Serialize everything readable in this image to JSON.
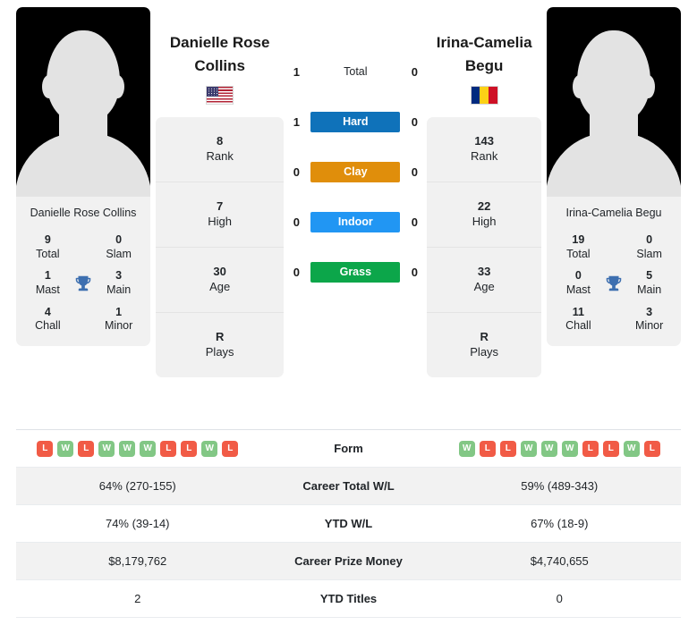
{
  "players": {
    "left": {
      "name": "Danielle Rose Collins",
      "photo_caption": "Danielle Rose Collins",
      "country_code": "us",
      "titles": {
        "total_num": "9",
        "total_label": "Total",
        "slam_num": "0",
        "slam_label": "Slam",
        "mast_num": "1",
        "mast_label": "Mast",
        "main_num": "3",
        "main_label": "Main",
        "chall_num": "4",
        "chall_label": "Chall",
        "minor_num": "1",
        "minor_label": "Minor"
      },
      "attributes": [
        {
          "value": "8",
          "label": "Rank"
        },
        {
          "value": "7",
          "label": "High"
        },
        {
          "value": "30",
          "label": "Age"
        },
        {
          "value": "R",
          "label": "Plays"
        }
      ],
      "surface_scores": {
        "total": "1",
        "hard": "1",
        "clay": "0",
        "indoor": "0",
        "grass": "0"
      },
      "form": [
        "L",
        "W",
        "L",
        "W",
        "W",
        "W",
        "L",
        "L",
        "W",
        "L"
      ],
      "career_total_wl": "64% (270-155)",
      "ytd_wl": "74% (39-14)",
      "career_prize_money": "$8,179,762",
      "ytd_titles": "2"
    },
    "right": {
      "name": "Irina-Camelia Begu",
      "photo_caption": "Irina-Camelia Begu",
      "country_code": "ro",
      "titles": {
        "total_num": "19",
        "total_label": "Total",
        "slam_num": "0",
        "slam_label": "Slam",
        "mast_num": "0",
        "mast_label": "Mast",
        "main_num": "5",
        "main_label": "Main",
        "chall_num": "11",
        "chall_label": "Chall",
        "minor_num": "3",
        "minor_label": "Minor"
      },
      "attributes": [
        {
          "value": "143",
          "label": "Rank"
        },
        {
          "value": "22",
          "label": "High"
        },
        {
          "value": "33",
          "label": "Age"
        },
        {
          "value": "R",
          "label": "Plays"
        }
      ],
      "surface_scores": {
        "total": "0",
        "hard": "0",
        "clay": "0",
        "indoor": "0",
        "grass": "0"
      },
      "form": [
        "W",
        "L",
        "L",
        "W",
        "W",
        "W",
        "L",
        "L",
        "W",
        "L"
      ],
      "career_total_wl": "59% (489-343)",
      "ytd_wl": "67% (18-9)",
      "career_prize_money": "$4,740,655",
      "ytd_titles": "0"
    }
  },
  "surfaces": [
    {
      "key": "total",
      "label": "Total",
      "color": "transparent"
    },
    {
      "key": "hard",
      "label": "Hard",
      "color": "#0f72ba"
    },
    {
      "key": "clay",
      "label": "Clay",
      "color": "#e08e0b"
    },
    {
      "key": "indoor",
      "label": "Indoor",
      "color": "#2196f3"
    },
    {
      "key": "grass",
      "label": "Grass",
      "color": "#0ca64a"
    }
  ],
  "table_labels": {
    "form": "Form",
    "career_total_wl": "Career Total W/L",
    "ytd_wl": "YTD W/L",
    "career_prize_money": "Career Prize Money",
    "ytd_titles": "YTD Titles"
  },
  "colors": {
    "hard": "#0f72ba",
    "clay": "#e08e0b",
    "indoor": "#2196f3",
    "grass": "#0ca64a",
    "win_badge": "#82c785",
    "loss_badge": "#f15b46",
    "trophy": "#3d6fb0",
    "card_bg": "#f1f1f1"
  },
  "icons": {
    "trophy": "trophy-icon",
    "flag_us": "flag-usa-icon",
    "flag_ro": "flag-romania-icon",
    "avatar": "player-avatar-placeholder"
  }
}
